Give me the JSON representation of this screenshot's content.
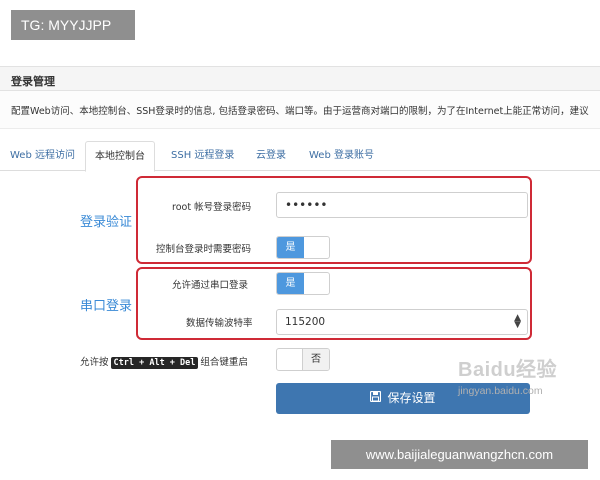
{
  "overlay": {
    "tag": "TG: MYYJJPP",
    "url": "www.baijialeguanwangzhcn.com"
  },
  "panel": {
    "title": "登录管理",
    "description": "配置Web访问、本地控制台、SSH登录时的信息, 包括登录密码、端口等。由于运营商对端口的限制，为了在Internet上能正常访问，建议"
  },
  "tabs": [
    {
      "label": "Web 远程访问",
      "active": false
    },
    {
      "label": "本地控制台",
      "active": true
    },
    {
      "label": "SSH 远程登录",
      "active": false
    },
    {
      "label": "云登录",
      "active": false
    },
    {
      "label": "Web 登录账号",
      "active": false
    }
  ],
  "sections": {
    "auth": {
      "title": "登录验证",
      "root_password_label": "root 帐号登录密码",
      "root_password_value": "••••••",
      "console_need_password_label": "控制台登录时需要密码",
      "console_need_password_toggle": "是"
    },
    "serial": {
      "title": "串口登录",
      "allow_serial_label": "允许通过串口登录",
      "allow_serial_toggle": "是",
      "baud_rate_label": "数据传输波特率",
      "baud_rate_value": "115200"
    }
  },
  "reboot": {
    "label_prefix": "允许按",
    "keys": "Ctrl + Alt + Del",
    "label_suffix": "组合键重启",
    "toggle_off": "否"
  },
  "save_button": {
    "label": "保存设置",
    "icon": "save-icon"
  },
  "watermark": {
    "brand": "Baidu经验",
    "site": "jingyan.baidu.com"
  },
  "colors": {
    "primary": "#3e76b0",
    "toggle_on": "#4e98de",
    "highlight_box": "#cf2a36",
    "section_title": "#3a8ad6"
  }
}
